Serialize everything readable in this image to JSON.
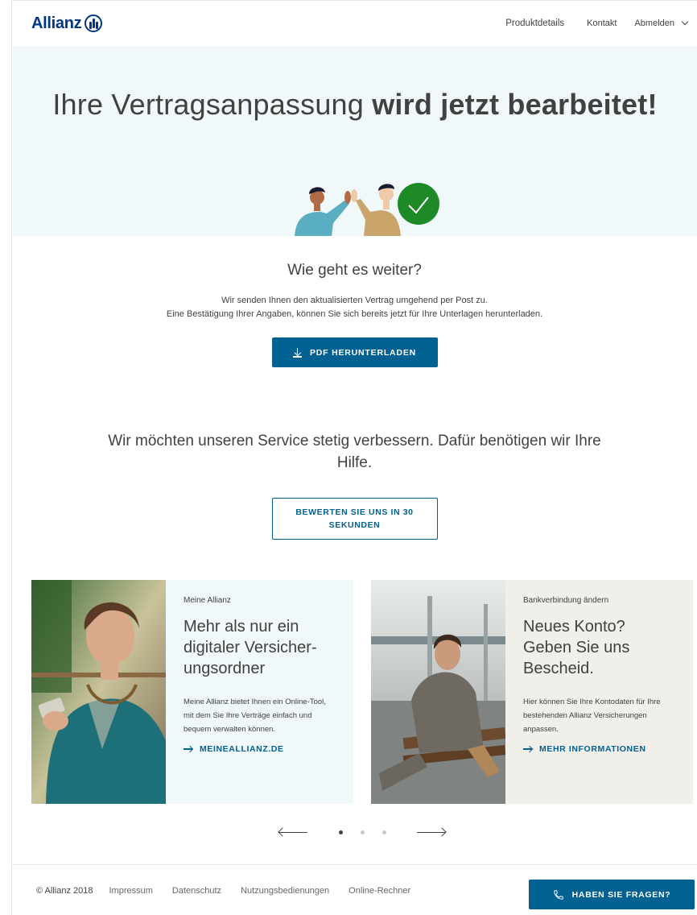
{
  "header": {
    "logo_text": "Allianz",
    "nav": {
      "product_details": "Produktdetails",
      "contact": "Kontakt",
      "logout": "Abmelden"
    }
  },
  "hero": {
    "title_light": "Ihre Vertragsanpassung ",
    "title_bold": "wird jetzt bearbeitet!"
  },
  "next_steps": {
    "heading": "Wie geht es weiter?",
    "line1": "Wir senden Ihnen den aktualisierten Vertrag umgehend per Post zu.",
    "line2": "Eine Bestätigung Ihrer Angaben, können Sie sich bereits jetzt für Ihre Unterlagen herunterladen.",
    "download_label": "PDF HERUNTERLADEN"
  },
  "feedback": {
    "text": "Wir möchten unseren Service stetig verbessern. Dafür benötigen wir Ihre Hilfe.",
    "rate_label": "BEWERTEN SIE UNS IN 30 SEKUNDEN"
  },
  "cards": [
    {
      "eyebrow": "Meine Allianz",
      "title": "Mehr als nur ein digitaler Versicher-ungsordner",
      "text": "Meine Allianz bietet Ihnen ein Online-Tool, mit dem Sie Ihre Verträge einfach und bequem verwalten können.",
      "link": "MEINEALLIANZ.DE"
    },
    {
      "eyebrow": "Bankverbindung ändern",
      "title": "Neues Konto? Geben Sie uns Bescheid.",
      "text": "Hier können Sie Ihre Kontodaten für Ihre bestehenden Allianz Versicherungen anpassen.",
      "link": "MEHR INFORMATIONEN"
    }
  ],
  "carousel": {
    "active_index": 0,
    "count": 3
  },
  "footer": {
    "copyright": "© Allianz 2018",
    "links": [
      "Impressum",
      "Datenschutz",
      "Nutzungsbedienungen",
      "Online-Rechner"
    ],
    "help_label": "HABEN SIE FRAGEN?"
  },
  "colors": {
    "brand": "#003781",
    "button": "#006192",
    "hero_bg": "#f1f8f9",
    "card2_bg": "#f1efea",
    "check_green": "#1e8927"
  },
  "icons": [
    "logo-mark-icon",
    "chevron-down-icon",
    "download-icon",
    "arrow-right-icon",
    "arrow-left-icon",
    "phone-icon",
    "checkmark-icon"
  ]
}
